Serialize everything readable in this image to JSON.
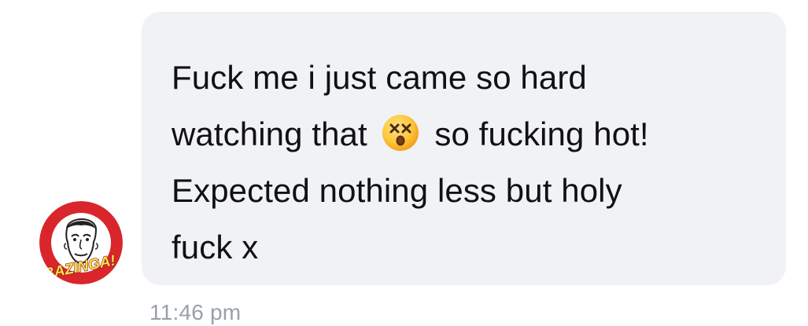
{
  "message": {
    "lines": [
      {
        "text": "Fuck me i just came so hard"
      },
      {
        "before_emoji": "watching that",
        "emoji": "dizzy-face-emoji",
        "after_emoji": "so fucking hot!"
      },
      {
        "text": "Expected nothing less but holy"
      },
      {
        "text": "fuck x"
      }
    ]
  },
  "avatar": {
    "label": "BAZINGA!"
  },
  "timestamp": "11:46 pm",
  "colors": {
    "bubble_bg": "#f0f2f5",
    "text": "#111111",
    "timestamp": "#9aa0a6",
    "avatar_ring": "#d9262d"
  }
}
